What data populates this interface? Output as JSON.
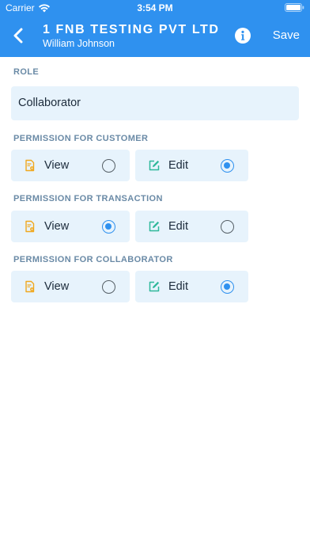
{
  "status_bar": {
    "carrier": "Carrier",
    "time": "3:54 PM"
  },
  "header": {
    "company": "1 FNB TESTING PVT LTD",
    "user": "William Johnson",
    "save_label": "Save"
  },
  "role": {
    "label": "ROLE",
    "value": "Collaborator"
  },
  "permissions": [
    {
      "label": "PERMISSION FOR CUSTOMER",
      "view_label": "View",
      "view_selected": false,
      "edit_label": "Edit",
      "edit_selected": true
    },
    {
      "label": "PERMISSION FOR TRANSACTION",
      "view_label": "View",
      "view_selected": true,
      "edit_label": "Edit",
      "edit_selected": false
    },
    {
      "label": "PERMISSION FOR COLLABORATOR",
      "view_label": "View",
      "view_selected": false,
      "edit_label": "Edit",
      "edit_selected": true
    }
  ],
  "colors": {
    "accent": "#2f91ef",
    "card_bg": "#e7f3fc",
    "section_label": "#6a8aa6",
    "view_icon": "#f0a81e",
    "edit_icon": "#2fb89a"
  },
  "icons": {
    "back": "chevron-left-icon",
    "info": "info-icon",
    "view": "document-view-icon",
    "edit": "edit-pencil-icon"
  }
}
